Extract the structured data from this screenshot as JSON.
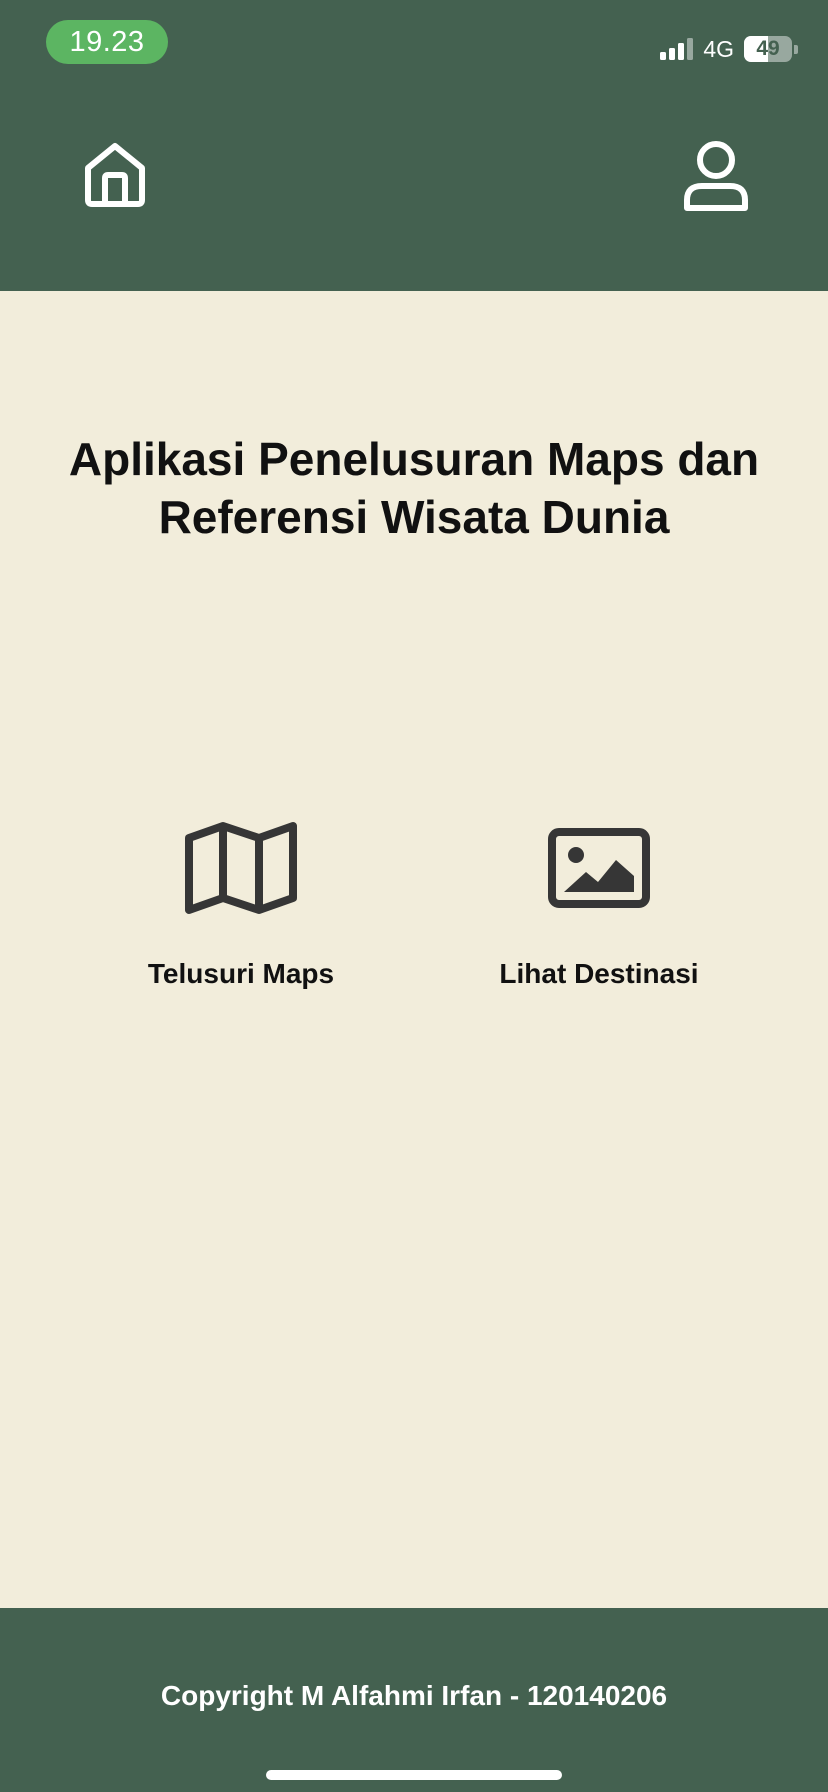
{
  "status_bar": {
    "time": "19.23",
    "network": "4G",
    "battery": "49",
    "battery_level": 0.49,
    "signal_bars_active": 3,
    "signal_bars_total": 4
  },
  "nav": {
    "home_icon": "home-icon",
    "profile_icon": "user-icon"
  },
  "main": {
    "title": "Aplikasi Penelusuran Maps dan Referensi Wisata Dunia",
    "menu": [
      {
        "label": "Telusuri Maps",
        "icon": "map-icon"
      },
      {
        "label": "Lihat Destinasi",
        "icon": "image-icon"
      }
    ]
  },
  "footer": {
    "copyright": "Copyright M Alfahmi Irfan - 120140206"
  },
  "colors": {
    "primary": "#446150",
    "background": "#f2eddb",
    "time_pill": "#5cb562",
    "icon_dark": "#363636",
    "text": "#111111"
  }
}
